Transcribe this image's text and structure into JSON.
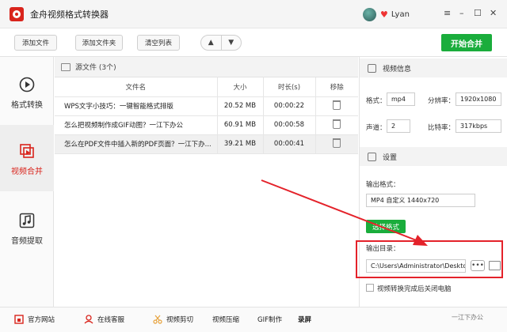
{
  "window": {
    "title": "金舟视频格式转换器",
    "username": "Lyan",
    "minimize": "–",
    "restore": "☐",
    "close": "✕",
    "menu": "≡"
  },
  "toolbar": {
    "add_file": "添加文件",
    "add_folder": "添加文件夹",
    "clear_list": "清空列表",
    "up": "▲",
    "down": "▼",
    "start_merge": "开始合并"
  },
  "sidebar": {
    "items": [
      {
        "label": "格式转换",
        "icon": "play-circle-icon"
      },
      {
        "label": "视频合并",
        "icon": "merge-icon",
        "active": true
      },
      {
        "label": "音频提取",
        "icon": "music-icon"
      }
    ]
  },
  "files": {
    "header": "源文件 (3个)",
    "columns": [
      "文件名",
      "大小",
      "时长(s)",
      "移除"
    ],
    "rows": [
      {
        "name": "WPS文字小技巧：一键智能格式排版",
        "size": "20.52 MB",
        "duration": "00:00:22"
      },
      {
        "name": "怎么把视频制作成GIF动图？一江下办公",
        "size": "60.91 MB",
        "duration": "00:00:58"
      },
      {
        "name": "怎么在PDF文件中插入新的PDF页面？一江下办...",
        "size": "39.21 MB",
        "duration": "00:00:41"
      }
    ]
  },
  "video_info": {
    "title": "视频信息",
    "format_label": "格式：",
    "format_value": "mp4",
    "resolution_label": "分辨率：",
    "resolution_value": "1920x1080",
    "channel_label": "声道：",
    "channel_value": "2",
    "bitrate_label": "比特率：",
    "bitrate_value": "317kbps"
  },
  "settings": {
    "title": "设置",
    "output_format_label": "输出格式：",
    "output_format_value": "MP4 自定义 1440x720",
    "format_button": "选择格式",
    "output_dir_label": "输出目录：",
    "output_dir_value": "C:\\Users\\Administrator\\Deskto",
    "browse": "•••",
    "shutdown_label": "视频转换完成后关闭电脑"
  },
  "bottom": {
    "items": [
      "官方网站",
      "在线客服",
      "视频剪切",
      "视频压缩",
      "GIF制作",
      "录屏"
    ],
    "watermark": "一江下办公"
  },
  "colors": {
    "accent_green": "#1aad3c",
    "brand_red": "#d9241c",
    "annotation_red": "#e4222a"
  }
}
